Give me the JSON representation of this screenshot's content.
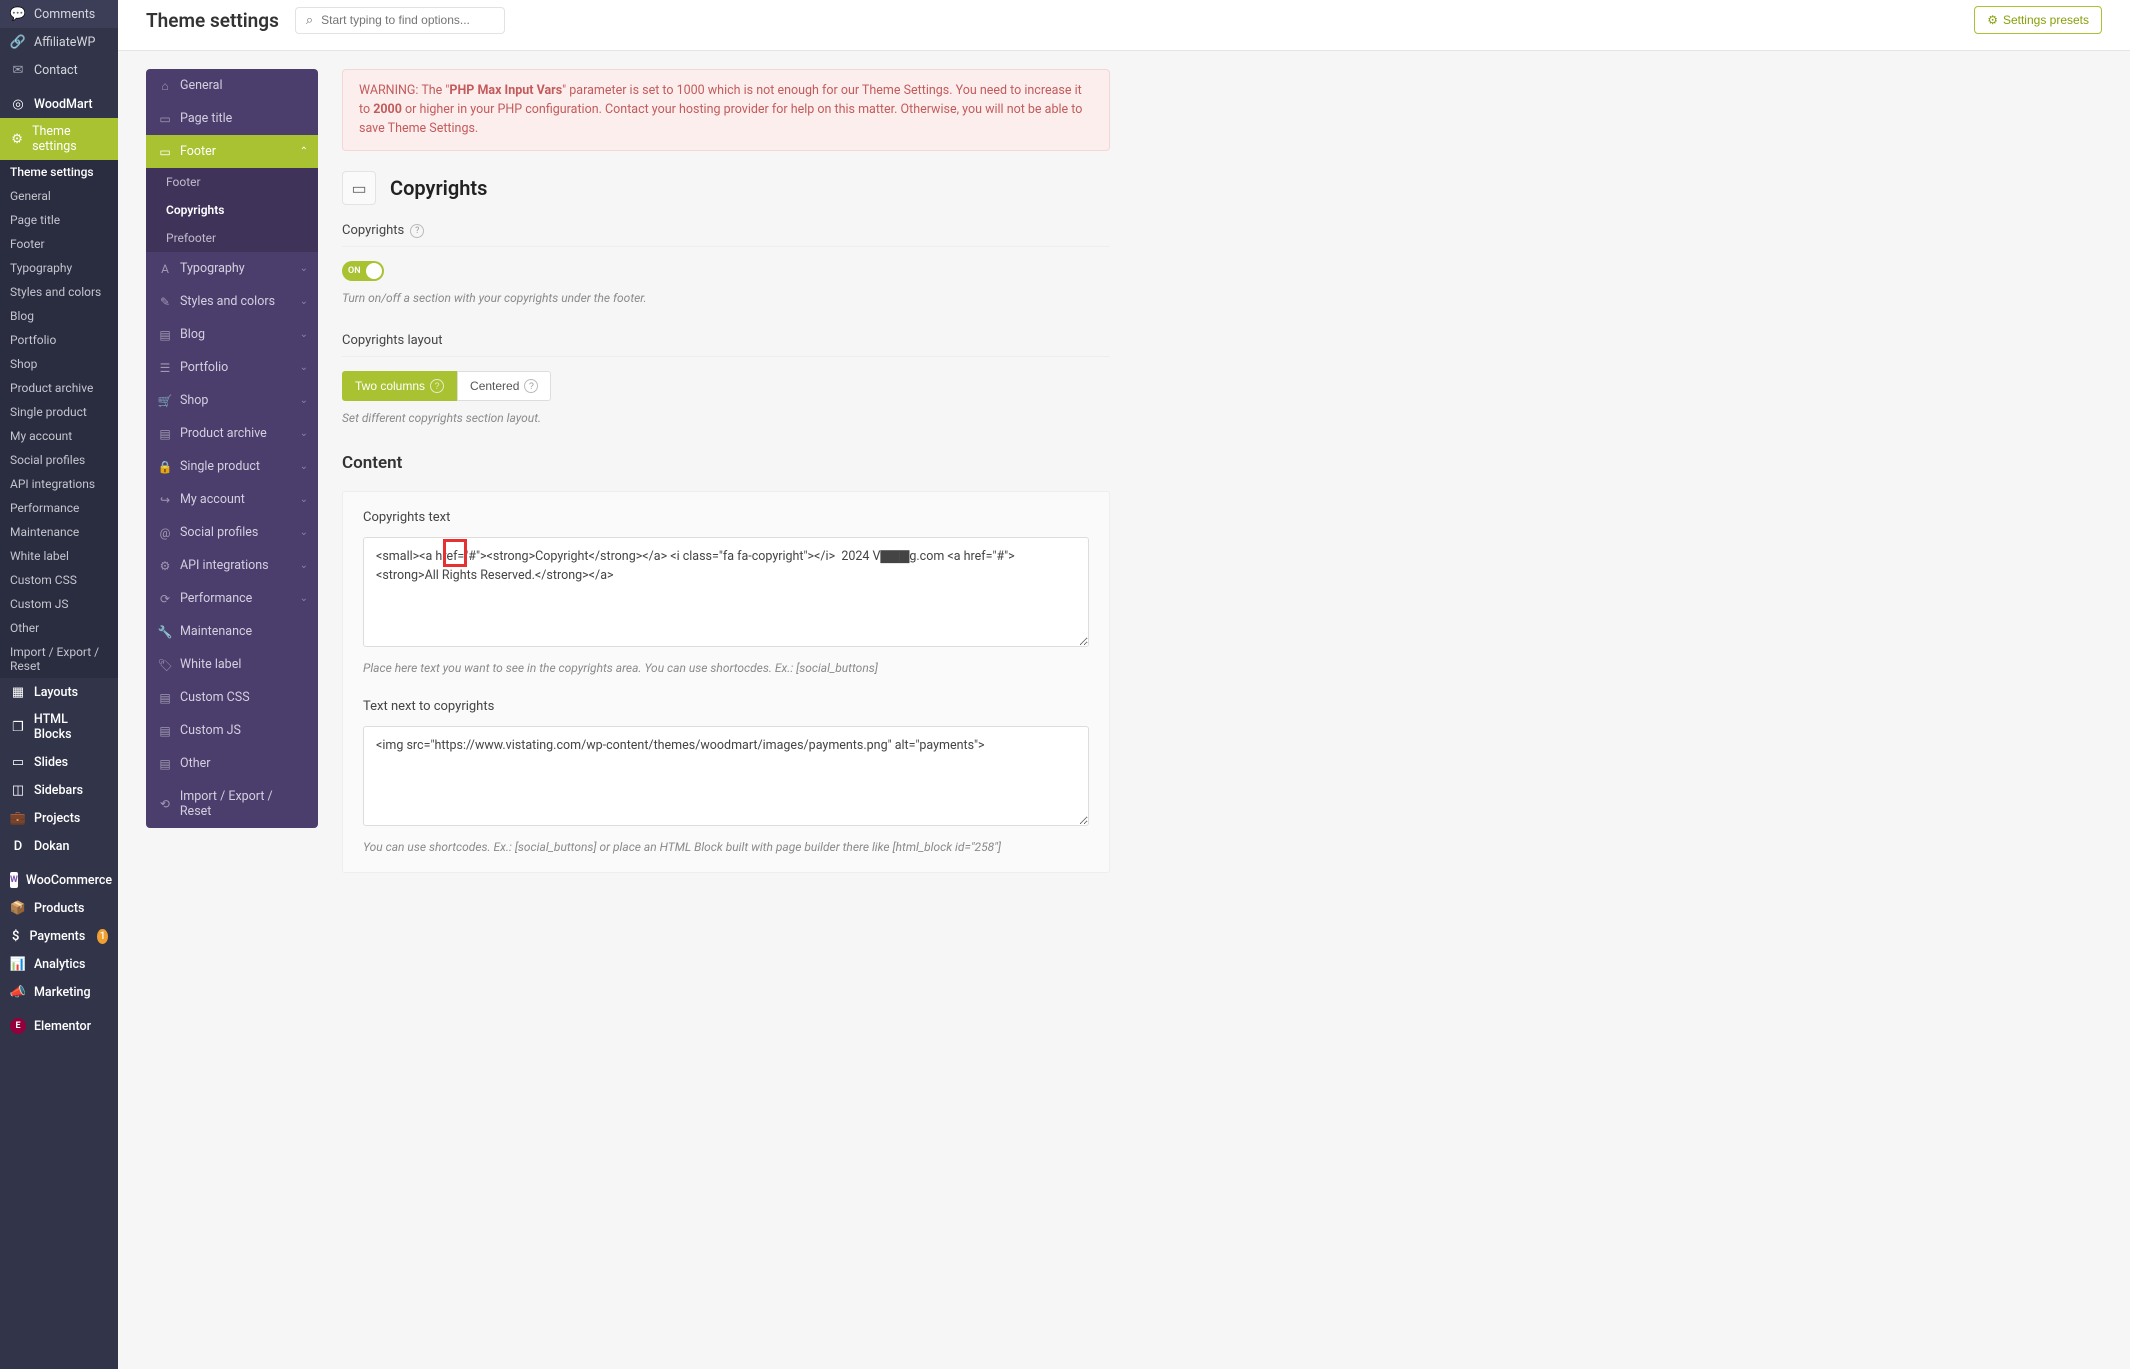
{
  "header": {
    "title": "Theme settings",
    "search_placeholder": "Start typing to find options...",
    "presets_label": "Settings presets"
  },
  "wp_sidebar": {
    "items_top": [
      {
        "label": "Comments",
        "icon": "💬"
      },
      {
        "label": "AffiliateWP",
        "icon": "🔗"
      },
      {
        "label": "Contact",
        "icon": "✉"
      }
    ],
    "woodmart_label": "WoodMart",
    "theme_settings_label": "Theme settings",
    "subitems": [
      "Theme settings",
      "General",
      "Page title",
      "Footer",
      "Typography",
      "Styles and colors",
      "Blog",
      "Portfolio",
      "Shop",
      "Product archive",
      "Single product",
      "My account",
      "Social profiles",
      "API integrations",
      "Performance",
      "Maintenance",
      "White label",
      "Custom CSS",
      "Custom JS",
      "Other",
      "Import / Export / Reset"
    ],
    "items_bottom": [
      {
        "label": "Layouts",
        "icon": "▦"
      },
      {
        "label": "HTML Blocks",
        "icon": "❐"
      },
      {
        "label": "Slides",
        "icon": "▭"
      },
      {
        "label": "Sidebars",
        "icon": "◫"
      },
      {
        "label": "Projects",
        "icon": "💼"
      },
      {
        "label": "Dokan",
        "icon": "D"
      },
      {
        "label": "WooCommerce",
        "icon": "W"
      },
      {
        "label": "Products",
        "icon": "📦"
      },
      {
        "label": "Payments",
        "icon": "$",
        "badge": "1"
      },
      {
        "label": "Analytics",
        "icon": "📊"
      },
      {
        "label": "Marketing",
        "icon": "📣"
      },
      {
        "label": "Elementor",
        "icon": "E"
      }
    ]
  },
  "ts_sidebar": {
    "groups": [
      {
        "label": "General",
        "icon": "⌂"
      },
      {
        "label": "Page title",
        "icon": "▭"
      },
      {
        "label": "Footer",
        "icon": "▭",
        "open": true,
        "children": [
          "Footer",
          "Copyrights",
          "Prefooter"
        ],
        "active_child": "Copyrights"
      },
      {
        "label": "Typography",
        "icon": "A"
      },
      {
        "label": "Styles and colors",
        "icon": "✎"
      },
      {
        "label": "Blog",
        "icon": "▤"
      },
      {
        "label": "Portfolio",
        "icon": "☰"
      },
      {
        "label": "Shop",
        "icon": "🛒"
      },
      {
        "label": "Product archive",
        "icon": "▤"
      },
      {
        "label": "Single product",
        "icon": "🔒"
      },
      {
        "label": "My account",
        "icon": "↪"
      },
      {
        "label": "Social profiles",
        "icon": "@"
      },
      {
        "label": "API integrations",
        "icon": "⚙"
      },
      {
        "label": "Performance",
        "icon": "⟳"
      },
      {
        "label": "Maintenance",
        "icon": "🔧"
      },
      {
        "label": "White label",
        "icon": "🏷"
      },
      {
        "label": "Custom CSS",
        "icon": "▤"
      },
      {
        "label": "Custom JS",
        "icon": "▤"
      },
      {
        "label": "Other",
        "icon": "▤"
      },
      {
        "label": "Import / Export / Reset",
        "icon": "⟲"
      }
    ]
  },
  "warning": {
    "pre": "WARNING: The \"",
    "bold1": "PHP Max Input Vars",
    "mid": "\" parameter is set to 1000 which is not enough for our Theme Settings. You need to increase it to ",
    "bold2": "2000",
    "post": " or higher in your PHP configuration. Contact your hosting provider for help on this matter. Otherwise, you will not be able to save Theme Settings."
  },
  "section": {
    "title": "Copyrights",
    "field_copyrights_label": "Copyrights",
    "toggle_on": "ON",
    "toggle_hint": "Turn on/off a section with your copyrights under the footer.",
    "layout_label": "Copyrights layout",
    "layout_opt1": "Two columns",
    "layout_opt2": "Centered",
    "layout_hint": "Set different copyrights section layout.",
    "content_heading": "Content",
    "copyrights_text_label": "Copyrights text",
    "copyrights_text_value": "<small><a href=\"#\"><strong>Copyright</strong></a> <i class=\"fa fa-copyright\"></i>  2024 V▇▇▇g.com <a href=\"#\"><strong>All Rights Reserved.</strong></a>",
    "copyrights_text_hint": "Place here text you want to see in the copyrights area. You can use shortocdes. Ex.: [social_buttons]",
    "text_next_label": "Text next to copyrights",
    "text_next_value": "<img src=\"https://www.vistating.com/wp-content/themes/woodmart/images/payments.png\" alt=\"payments\">",
    "text_next_hint": "You can use shortcodes. Ex.: [social_buttons] or place an HTML Block built with page builder there like [html_block id=\"258\"]"
  }
}
